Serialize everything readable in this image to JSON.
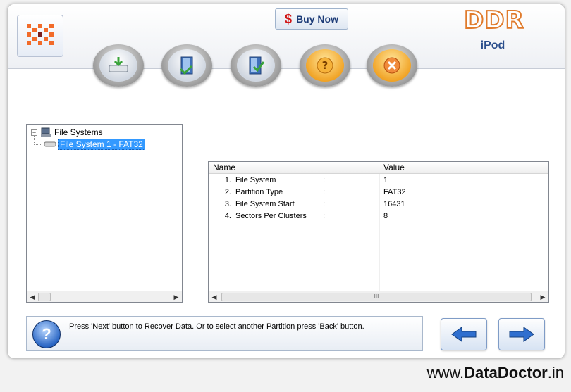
{
  "header": {
    "buy_now_label": "Buy Now",
    "buy_now_symbol": "$",
    "brand": "DDR",
    "brand_sub": "iPod"
  },
  "toolbar": {
    "tools": [
      {
        "name": "save-data-button",
        "icon": "drive-download-icon"
      },
      {
        "name": "open-recovered-button",
        "icon": "open-door-icon"
      },
      {
        "name": "recover-check-button",
        "icon": "door-check-icon"
      },
      {
        "name": "help-button",
        "icon": "question-icon"
      },
      {
        "name": "exit-button",
        "icon": "close-x-icon"
      }
    ]
  },
  "tree": {
    "root_toggle": "−",
    "root_label": "File Systems",
    "child_label": "File System 1 - FAT32"
  },
  "list": {
    "columns": [
      "Name",
      "Value"
    ],
    "rows": [
      {
        "num": "1.",
        "name": "File System",
        "colon": ":",
        "value": "1"
      },
      {
        "num": "2.",
        "name": "Partition Type",
        "colon": ":",
        "value": "FAT32"
      },
      {
        "num": "3.",
        "name": "File System Start",
        "colon": ":",
        "value": "16431"
      },
      {
        "num": "4.",
        "name": "Sectors Per Clusters",
        "colon": ":",
        "value": "8"
      }
    ],
    "scroll_grip": "III"
  },
  "status": {
    "icon_glyph": "?",
    "text": "Press 'Next' button to Recover Data. Or to select another Partition press 'Back' button."
  },
  "nav": {
    "back_icon": "arrow-left-icon",
    "next_icon": "arrow-right-icon"
  },
  "footer": {
    "prefix": "www.",
    "name": "DataDoctor",
    "suffix": ".in"
  },
  "colors": {
    "accent_blue": "#2a66c4",
    "brand_orange": "#e07b2c",
    "selection": "#3399ff"
  }
}
